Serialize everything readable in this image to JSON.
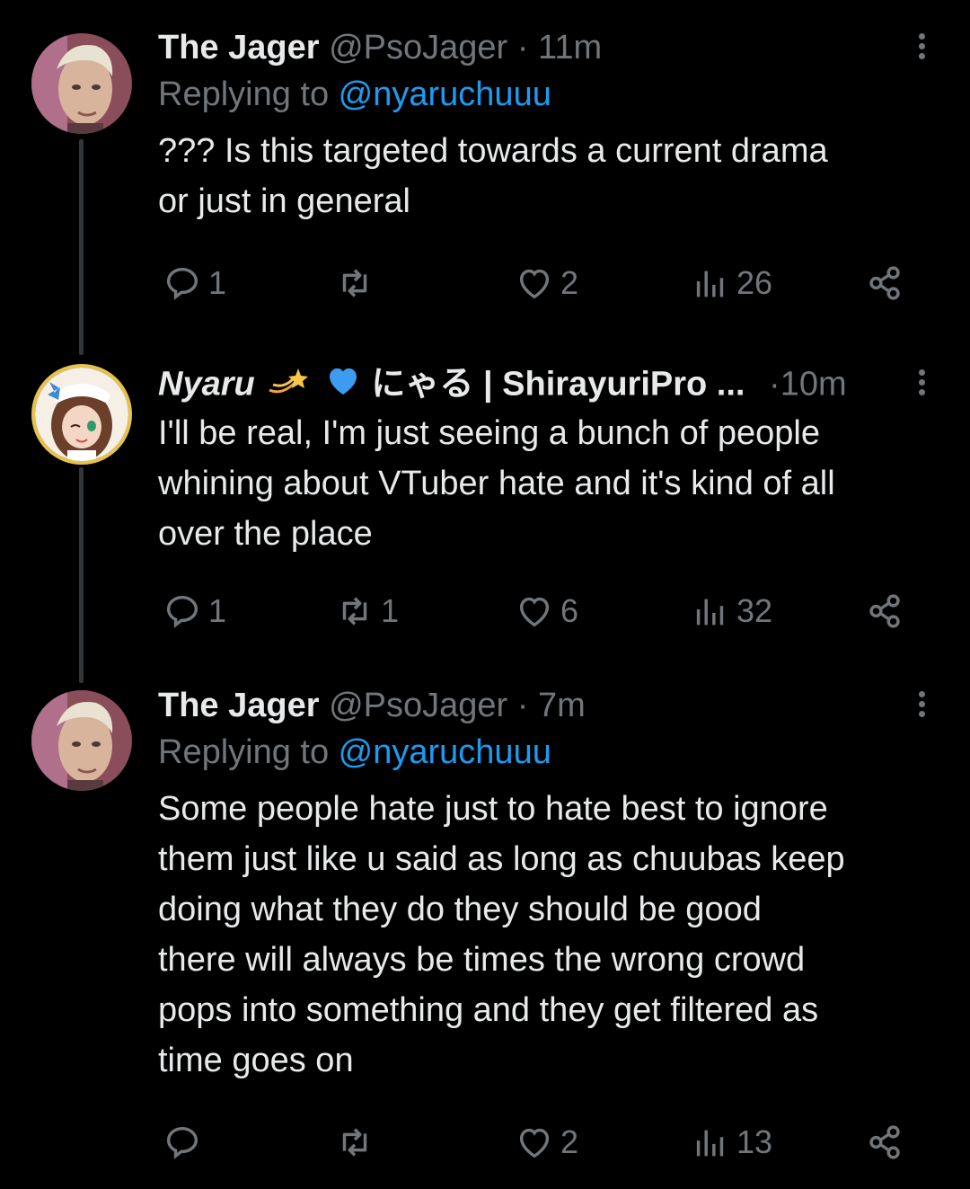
{
  "tweets": [
    {
      "name": "The Jager",
      "handle": "@PsoJager",
      "dot": "·",
      "time": "11m",
      "replying_prefix": "Replying to ",
      "replying_to": "@nyaruchuuu",
      "text": "??? Is this targeted towards a current drama\nor just in general",
      "actions": {
        "replies": "1",
        "reposts": "",
        "likes": "2",
        "views": "26"
      }
    },
    {
      "name": "Nyaru",
      "name_rest": "にゃる | ShirayuriPro ...",
      "dot": "·",
      "time": "10m",
      "text": "I'll be real, I'm just seeing a bunch of people\nwhining about VTuber hate and it's kind of all\nover the place",
      "actions": {
        "replies": "1",
        "reposts": "1",
        "likes": "6",
        "views": "32"
      }
    },
    {
      "name": "The Jager",
      "handle": "@PsoJager",
      "dot": "·",
      "time": "7m",
      "replying_prefix": "Replying to ",
      "replying_to": "@nyaruchuuu",
      "text": "Some people hate just to hate best to ignore\nthem just like u said as long as chuubas keep\ndoing what they do they should be good\nthere will always be times the wrong crowd\npops into something and they get filtered as\ntime goes on",
      "actions": {
        "replies": "",
        "reposts": "",
        "likes": "2",
        "views": "13"
      }
    }
  ],
  "colors": {
    "background": "#000000",
    "text": "#e7e9ea",
    "muted": "#71767b",
    "link": "#1d9bf0",
    "thread_line": "#333639"
  },
  "icons": [
    "reply-icon",
    "repost-icon",
    "like-icon",
    "views-icon",
    "share-icon",
    "more-icon",
    "dizzy-emoji",
    "blue-heart-emoji"
  ]
}
